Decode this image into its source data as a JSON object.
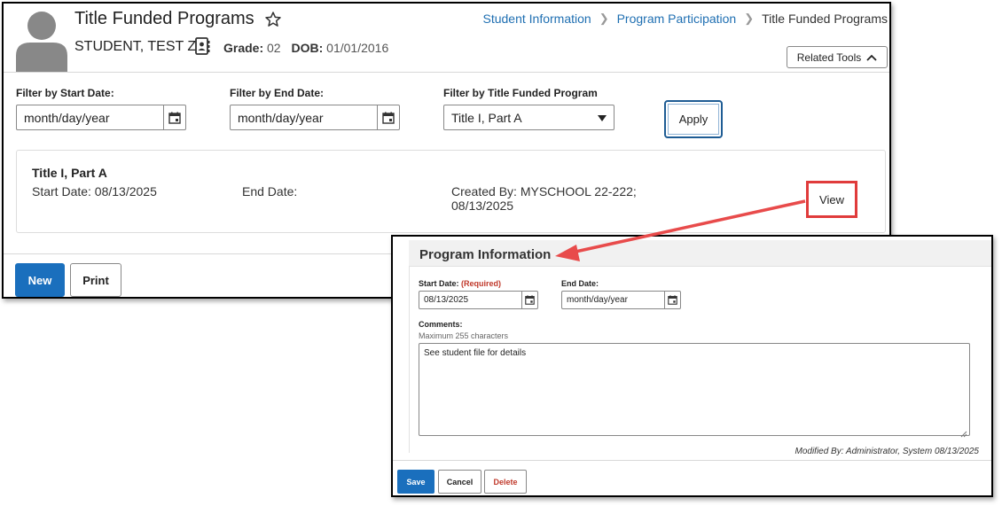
{
  "header": {
    "title": "Title Funded Programs",
    "student_name": "STUDENT, TEST Z",
    "grade_label": "Grade:",
    "grade_value": "02",
    "dob_label": "DOB:",
    "dob_value": "01/01/2016",
    "related_tools_label": "Related Tools"
  },
  "breadcrumb": {
    "items": [
      "Student Information",
      "Program Participation",
      "Title Funded Programs"
    ]
  },
  "filters": {
    "start_label": "Filter by Start Date:",
    "start_value": "month/day/year",
    "end_label": "Filter by End Date:",
    "end_value": "month/day/year",
    "program_label": "Filter by Title Funded Program",
    "program_value": "Title I, Part A",
    "apply_label": "Apply"
  },
  "record": {
    "title": "Title I, Part A",
    "start_date": "Start Date: 08/13/2025",
    "end_date": "End Date:",
    "created_by_line1": "Created By: MYSCHOOL 22-222;",
    "created_by_line2": "08/13/2025",
    "view_label": "View"
  },
  "footer": {
    "new_label": "New",
    "print_label": "Print"
  },
  "popup": {
    "title": "Program Information",
    "start_label": "Start Date:",
    "start_required": "(Required)",
    "start_value": "08/13/2025",
    "end_label": "End Date:",
    "end_value": "month/day/year",
    "comments_label": "Comments:",
    "comments_hint": "Maximum 255 characters",
    "comments_value": "See student file for details",
    "modified_by": "Modified By: Administrator, System 08/13/2025",
    "save_label": "Save",
    "cancel_label": "Cancel",
    "delete_label": "Delete"
  },
  "colors": {
    "link_blue": "#1f6fb2",
    "primary_button": "#1a6fbd",
    "annotation_red": "#e03b3b",
    "required_red": "#c0392b"
  },
  "icons": {
    "avatar": "person-silhouette-icon",
    "favorite": "star-outline-icon",
    "contact": "contact-card-icon",
    "calendar": "calendar-icon",
    "dropdown": "caret-down-icon",
    "related_tools": "chevron-up-icon"
  }
}
